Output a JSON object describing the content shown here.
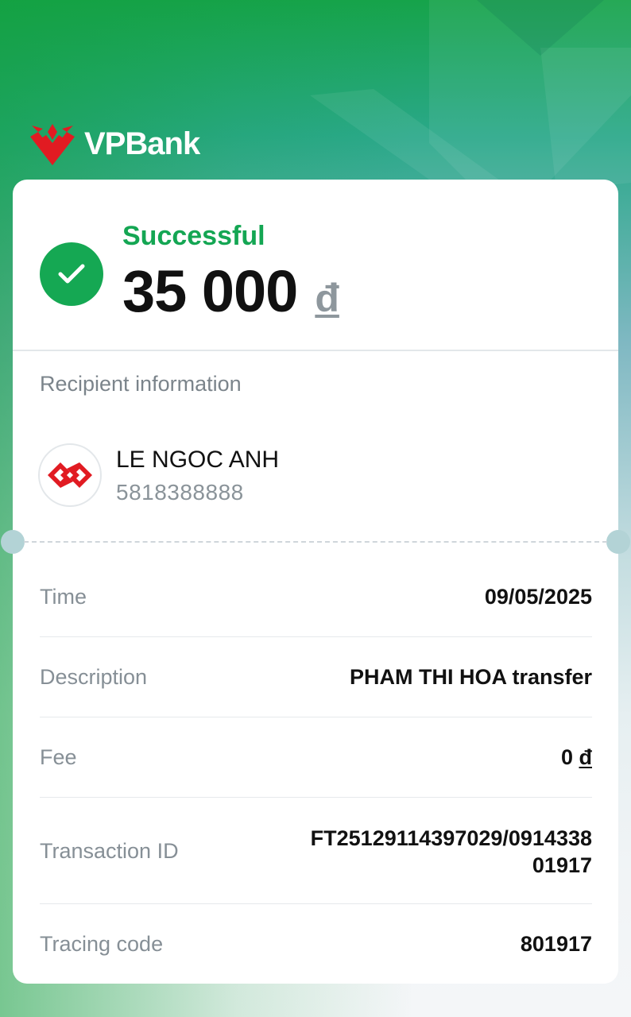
{
  "brand": {
    "name_main": "VPBan",
    "name_k": "k"
  },
  "status": {
    "text": "Successful",
    "amount": "35 000",
    "currency": "đ"
  },
  "recipient": {
    "section_label": "Recipient information",
    "name": "LE NGOC ANH",
    "account": "5818388888"
  },
  "details": {
    "time": {
      "label": "Time",
      "value": "09/05/2025"
    },
    "description": {
      "label": "Description",
      "value": "PHAM THI HOA transfer"
    },
    "fee": {
      "label": "Fee",
      "value": "0",
      "currency": "đ"
    },
    "transaction_id": {
      "label": "Transaction ID",
      "value_line1": "FT25129114397029/0914338",
      "value_line2": "01917"
    },
    "tracing_code": {
      "label": "Tracing code",
      "value": "801917"
    }
  },
  "colors": {
    "success": "#15a853",
    "brand_red": "#e11b22",
    "text": "#111111",
    "muted": "#868f96"
  },
  "icons": {
    "status": "check-icon",
    "bank": "bank-logo-icon",
    "brand": "vpbank-logo-icon"
  }
}
